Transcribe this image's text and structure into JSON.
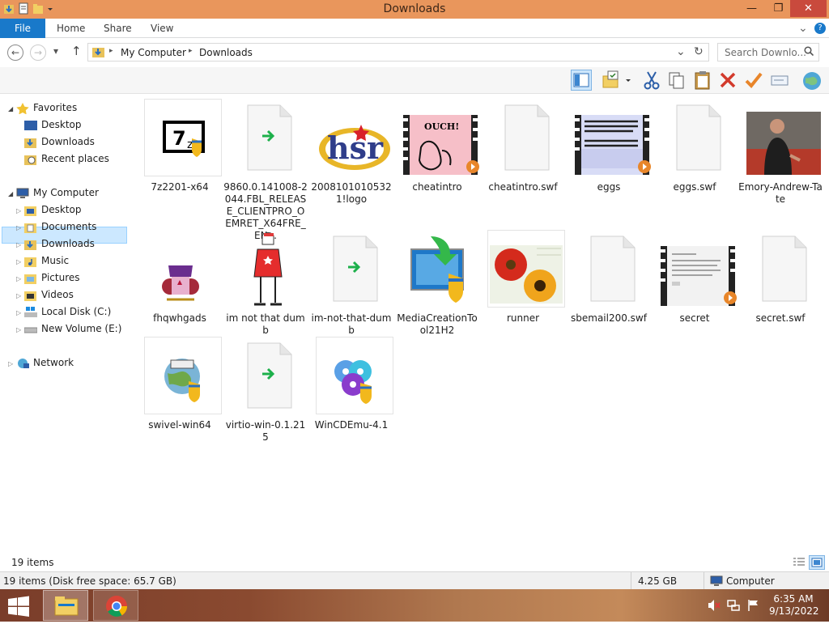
{
  "window": {
    "title": "Downloads",
    "minimize": "—",
    "maximize": "❐",
    "close": "✕"
  },
  "ribbon": {
    "file": "File",
    "tabs": [
      "Home",
      "Share",
      "View"
    ],
    "collapse": "⌄",
    "help": "?"
  },
  "address": {
    "back": "←",
    "forward": "→",
    "recent": "▾",
    "up": "↑",
    "path": [
      "My Computer",
      "Downloads"
    ],
    "sep": "▸",
    "dropdown": "⌄",
    "refresh": "↻",
    "search_placeholder": "Search Downlo...",
    "search_icon": "🔍"
  },
  "toolbar": {
    "icons": [
      "preview-pane-icon",
      "folder-options-icon",
      "dropdown-icon",
      "cut-icon",
      "copy-icon",
      "paste-icon",
      "delete-icon",
      "check-icon",
      "rename-icon",
      "globe-icon"
    ]
  },
  "sidebar": {
    "favorites": {
      "label": "Favorites",
      "items": [
        "Desktop",
        "Downloads",
        "Recent places"
      ],
      "selected": "Downloads"
    },
    "computer": {
      "label": "My Computer",
      "items": [
        "Desktop",
        "Documents",
        "Downloads",
        "Music",
        "Pictures",
        "Videos",
        "Local Disk (C:)",
        "New Volume (E:)"
      ]
    },
    "network": {
      "label": "Network"
    }
  },
  "files": [
    {
      "name": "7z2201-x64",
      "icon": "7zip-installer-icon"
    },
    {
      "name": "9860.0.141008-2044.FBL_RELEASE_CLIENTPRO_OEMRET_X64FRE_EN...",
      "icon": "shortcut-file-icon"
    },
    {
      "name": "20081010105321!logo",
      "icon": "hsr-logo-icon"
    },
    {
      "name": "cheatintro",
      "icon": "video-thumbnail-icon",
      "thumb": "OUCH!"
    },
    {
      "name": "cheatintro.swf",
      "icon": "blank-file-icon"
    },
    {
      "name": "eggs",
      "icon": "video-thumbnail-icon"
    },
    {
      "name": "eggs.swf",
      "icon": "blank-file-icon"
    },
    {
      "name": "Emory-Andrew-Tate",
      "icon": "photo-thumbnail-icon"
    },
    {
      "name": "fhqwhgads",
      "icon": "character-image-icon"
    },
    {
      "name": "im not that dumb",
      "icon": "character-image-icon"
    },
    {
      "name": "im-not-that-dumb",
      "icon": "shortcut-file-icon"
    },
    {
      "name": "MediaCreationTool21H2",
      "icon": "media-creation-tool-icon"
    },
    {
      "name": "runner",
      "icon": "flower-image-icon"
    },
    {
      "name": "sbemail200.swf",
      "icon": "blank-file-icon"
    },
    {
      "name": "secret",
      "icon": "video-thumbnail-icon"
    },
    {
      "name": "secret.swf",
      "icon": "blank-file-icon"
    },
    {
      "name": "swivel-win64",
      "icon": "installer-globe-icon"
    },
    {
      "name": "virtio-win-0.1.215",
      "icon": "shortcut-file-icon"
    },
    {
      "name": "WinCDEmu-4.1",
      "icon": "disc-installer-icon"
    }
  ],
  "status": {
    "count": "19 items",
    "detail": "19 items (Disk free space: 65.7 GB)",
    "size": "4.25 GB",
    "location": "Computer"
  },
  "taskbar": {
    "time": "6:35 AM",
    "date": "9/13/2022"
  }
}
